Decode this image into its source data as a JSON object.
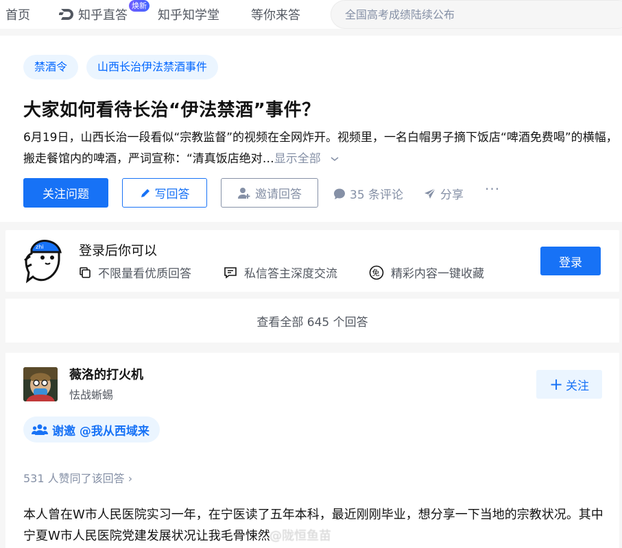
{
  "nav": {
    "home": "首页",
    "zhida": "知乎直答",
    "zhida_badge": "焕新",
    "school": "知乎知学堂",
    "wait": "等你来答",
    "search_placeholder": "全国高考成绩陆续公布"
  },
  "question": {
    "tags": [
      "禁酒令",
      "山西长治伊法禁酒事件"
    ],
    "title": "大家如何看待长治“伊法禁酒”事件？",
    "excerpt": "6月19日，山西长治一段看似“宗教监督”的视频在全网炸开。视频里，一名白帽男子摘下饭店“啤酒免费喝”的横幅，搬走餐馆内的啤酒，严词宣称：“清真饭店绝对…",
    "show_all": "显示全部",
    "follow_label": "关注问题",
    "write_label": "写回答",
    "invite_label": "邀请回答",
    "comments_label": "35 条评论",
    "share_label": "分享",
    "more_label": "···"
  },
  "login_card": {
    "title": "登录后你可以",
    "features": [
      "不限量看优质回答",
      "私信答主深度交流",
      "精彩内容一键收藏"
    ],
    "login_label": "登录"
  },
  "view_all": "查看全部 645 个回答",
  "answer": {
    "author": "薇洛的打火机",
    "author_desc": "怯战蜥蜴",
    "follow_label": "关注",
    "thanks": "谢邀 @我从西域来",
    "upvotes": "531 人赞同了该回答 ›",
    "body": "本人曾在W市人民医院实习一年，在宁医读了五年本科，最近刚刚毕业，想分享一下当地的宗教状况。其中宁夏W市人民医院党建发展状况让我毛骨悚然",
    "watermark": "@陇恒鱼苗"
  },
  "colors": {
    "brand_blue": "#1772f6",
    "tag_bg": "#ebf5ff",
    "muted": "#8590a6"
  }
}
